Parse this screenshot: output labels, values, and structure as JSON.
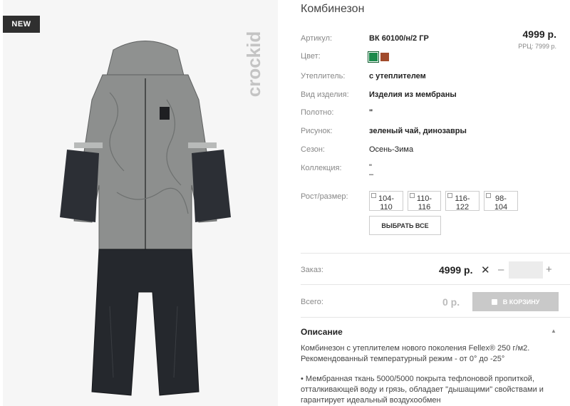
{
  "badge": "NEW",
  "brand": "crockid",
  "product": {
    "title": "Комбинезон",
    "price": "4999 р.",
    "rrp": "РРЦ: 7999 р."
  },
  "specs": [
    {
      "label": "Артикул:",
      "value": "ВК 60100/н/2 ГР"
    },
    {
      "label": "Цвет:",
      "value": ""
    },
    {
      "label": "Утеплитель:",
      "value": "с утеплителем"
    },
    {
      "label": "Вид изделия:",
      "value": "Изделия из мембраны"
    },
    {
      "label": "Полотно:",
      "value": "\""
    },
    {
      "label": "Рисунок:",
      "value": "зеленый чай, динозавры"
    },
    {
      "label": "Сезон:",
      "value": "Осень-Зима"
    },
    {
      "label": "Коллекция:",
      "value": "\" –"
    }
  ],
  "colors": {
    "swatches": [
      "#1b8a4b",
      "#a14b2c"
    ]
  },
  "sizes": {
    "label": "Рост/размер:",
    "options": [
      "104-110",
      "110-116",
      "116-122",
      "98-104"
    ],
    "select_all": "ВЫБРАТЬ ВСЕ"
  },
  "order": {
    "label": "Заказ:",
    "price": "4999 р.",
    "remove": "✕",
    "minus": "–",
    "plus": "+",
    "qty": ""
  },
  "total": {
    "label": "Всего:",
    "value": "0 р.",
    "cart_label": "В КОРЗИНУ"
  },
  "description": {
    "title": "Описание",
    "toggle": "▲",
    "para1": "Комбинезон с утеплителем нового поколения Fellex® 250 г/м2. Рекомендованный температурный режим - от 0° до -25°",
    "para2": "• Мембранная ткань 5000/5000 покрыта тефлоновой пропиткой, отталкивающей воду и грязь, обладает \"дышащими\" свойствами и гарантирует идеальный воздухообмен"
  }
}
